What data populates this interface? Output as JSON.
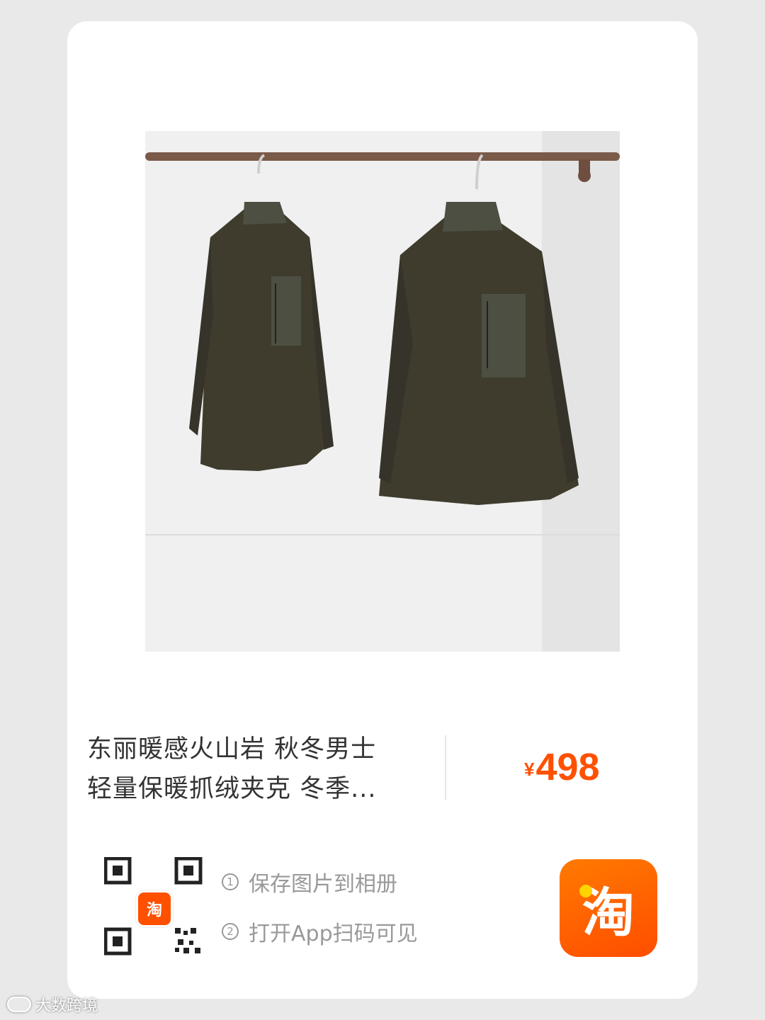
{
  "product": {
    "title_line1": "东丽暖感火山岩 秋冬男士",
    "title_line2": "轻量保暖抓绒夹克 冬季...",
    "price_symbol": "¥",
    "price_value": "498"
  },
  "share": {
    "qr_badge": "淘",
    "step1_num": "1",
    "step1_text": "保存图片到相册",
    "step2_num": "2",
    "step2_text": "打开App扫码可见"
  },
  "app_icon": {
    "glyph": "淘"
  },
  "watermark": {
    "text": "大数跨境"
  },
  "colors": {
    "accent": "#ff5000",
    "jacket": "#3f3c2e",
    "pocket": "#4c4f42"
  }
}
